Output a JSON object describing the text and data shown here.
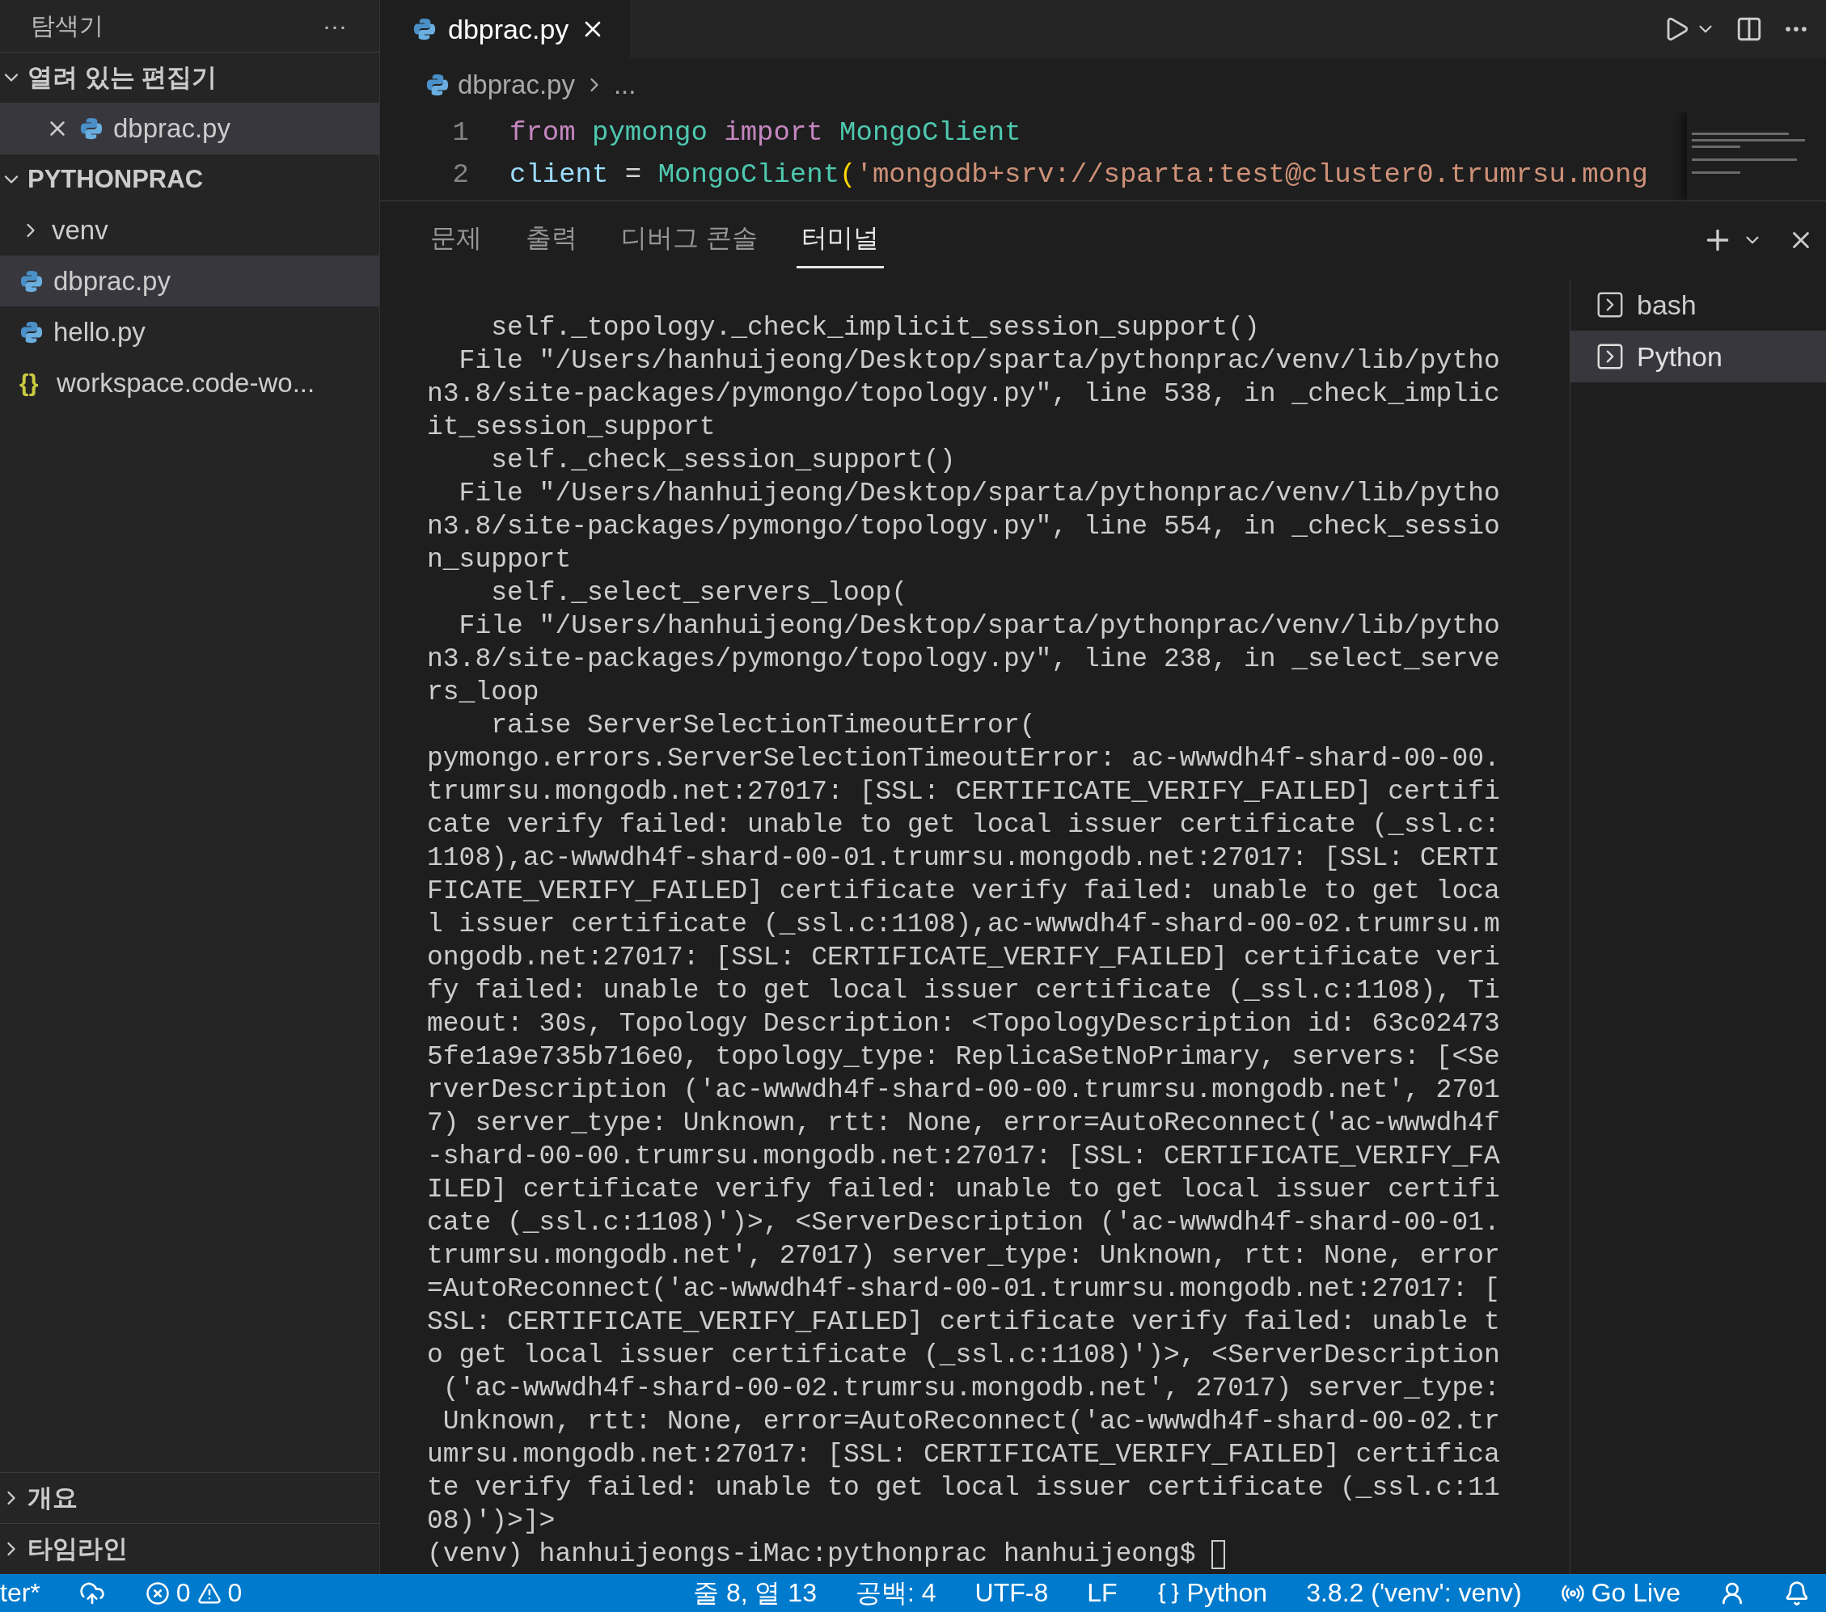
{
  "sidebar": {
    "title": "탐색기",
    "more": "···",
    "sections": [
      {
        "title": "열려 있는 편집기",
        "expanded": true,
        "kind": "open_editors",
        "items": [
          {
            "name": "dbprac.py",
            "kind": "python",
            "selected": true
          }
        ]
      },
      {
        "title": "PYTHONPRAC",
        "expanded": true,
        "kind": "folder",
        "items": [
          {
            "name": "venv",
            "kind": "folder",
            "expanded": false,
            "selected": false
          },
          {
            "name": "dbprac.py",
            "kind": "python",
            "selected": true
          },
          {
            "name": "hello.py",
            "kind": "python",
            "selected": false
          },
          {
            "name": "workspace.code-wo...",
            "kind": "workspace",
            "icon_glyph": "{}",
            "selected": false
          }
        ]
      }
    ],
    "bottom_sections": [
      {
        "title": "개요",
        "expanded": false
      },
      {
        "title": "타임라인",
        "expanded": false
      }
    ]
  },
  "editor": {
    "tabs": [
      {
        "label": "dbprac.py",
        "selected": true
      }
    ],
    "breadcrumb": [
      "dbprac.py",
      "..."
    ],
    "lines": [
      {
        "number": "1",
        "tokens": [
          {
            "text": "from ",
            "kind": "keyword"
          },
          {
            "text": "pymongo ",
            "kind": "module"
          },
          {
            "text": "import ",
            "kind": "keyword"
          },
          {
            "text": "MongoClient",
            "kind": "class"
          }
        ]
      },
      {
        "number": "2",
        "tokens": [
          {
            "text": "client",
            "kind": "variable"
          },
          {
            "text": " = ",
            "kind": "plain"
          },
          {
            "text": "MongoClient",
            "kind": "class"
          },
          {
            "text": "(",
            "kind": "bracket"
          },
          {
            "text": "'mongodb+srv://sparta:test@cluster0.trumrsu.mong",
            "kind": "string"
          }
        ]
      }
    ]
  },
  "panel": {
    "tabs": [
      {
        "label": "문제",
        "selected": false
      },
      {
        "label": "출력",
        "selected": false
      },
      {
        "label": "디버그 콘솔",
        "selected": false
      },
      {
        "label": "터미널",
        "selected": true
      }
    ],
    "terminal_lines": [
      "    self._topology._check_implicit_session_support()",
      "  File \"/Users/hanhuijeong/Desktop/sparta/pythonprac/venv/lib/pytho",
      "n3.8/site-packages/pymongo/topology.py\", line 538, in _check_implic",
      "it_session_support",
      "    self._check_session_support()",
      "  File \"/Users/hanhuijeong/Desktop/sparta/pythonprac/venv/lib/pytho",
      "n3.8/site-packages/pymongo/topology.py\", line 554, in _check_sessio",
      "n_support",
      "    self._select_servers_loop(",
      "  File \"/Users/hanhuijeong/Desktop/sparta/pythonprac/venv/lib/pytho",
      "n3.8/site-packages/pymongo/topology.py\", line 238, in _select_serve",
      "rs_loop",
      "    raise ServerSelectionTimeoutError(",
      "pymongo.errors.ServerSelectionTimeoutError: ac-wwwdh4f-shard-00-00.",
      "trumrsu.mongodb.net:27017: [SSL: CERTIFICATE_VERIFY_FAILED] certifi",
      "cate verify failed: unable to get local issuer certificate (_ssl.c:",
      "1108),ac-wwwdh4f-shard-00-01.trumrsu.mongodb.net:27017: [SSL: CERTI",
      "FICATE_VERIFY_FAILED] certificate verify failed: unable to get loca",
      "l issuer certificate (_ssl.c:1108),ac-wwwdh4f-shard-00-02.trumrsu.m",
      "ongodb.net:27017: [SSL: CERTIFICATE_VERIFY_FAILED] certificate veri",
      "fy failed: unable to get local issuer certificate (_ssl.c:1108), Ti",
      "meout: 30s, Topology Description: <TopologyDescription id: 63c02473",
      "5fe1a9e735b716e0, topology_type: ReplicaSetNoPrimary, servers: [<Se",
      "rverDescription ('ac-wwwdh4f-shard-00-00.trumrsu.mongodb.net', 2701",
      "7) server_type: Unknown, rtt: None, error=AutoReconnect('ac-wwwdh4f",
      "-shard-00-00.trumrsu.mongodb.net:27017: [SSL: CERTIFICATE_VERIFY_FA",
      "ILED] certificate verify failed: unable to get local issuer certifi",
      "cate (_ssl.c:1108)')>, <ServerDescription ('ac-wwwdh4f-shard-00-01.",
      "trumrsu.mongodb.net', 27017) server_type: Unknown, rtt: None, error",
      "=AutoReconnect('ac-wwwdh4f-shard-00-01.trumrsu.mongodb.net:27017: [",
      "SSL: CERTIFICATE_VERIFY_FAILED] certificate verify failed: unable t",
      "o get local issuer certificate (_ssl.c:1108)')>, <ServerDescription",
      " ('ac-wwwdh4f-shard-00-02.trumrsu.mongodb.net', 27017) server_type:",
      " Unknown, rtt: None, error=AutoReconnect('ac-wwwdh4f-shard-00-02.tr",
      "umrsu.mongodb.net:27017: [SSL: CERTIFICATE_VERIFY_FAILED] certifica",
      "te verify failed: unable to get local issuer certificate (_ssl.c:11",
      "08)')>]>"
    ],
    "prompt": "(venv) hanhuijeongs-iMac:pythonprac hanhuijeong$ ",
    "terminals": [
      {
        "label": "bash",
        "selected": false
      },
      {
        "label": "Python",
        "selected": true
      }
    ]
  },
  "status_bar": {
    "branch": "ter*",
    "errors": "0",
    "warnings": "0",
    "position": "줄 8, 열 13",
    "spaces": "공백: 4",
    "encoding": "UTF-8",
    "eol": "LF",
    "language": "Python",
    "interpreter": "3.8.2 ('venv': venv)",
    "live": "Go Live"
  }
}
